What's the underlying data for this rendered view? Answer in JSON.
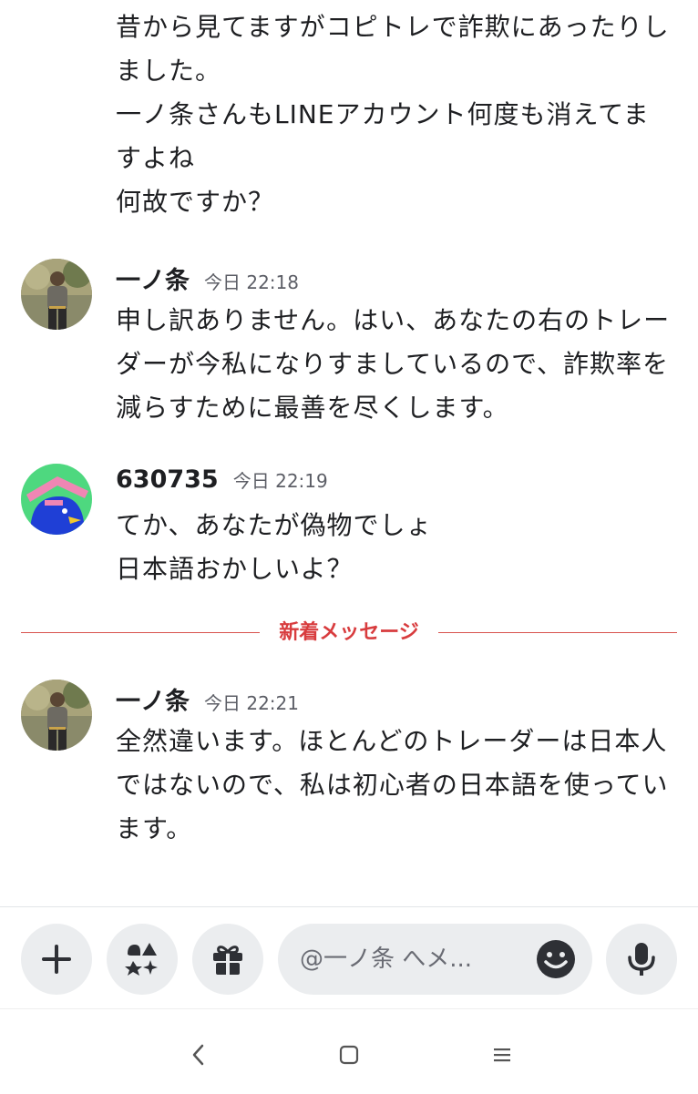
{
  "messages": {
    "m0": {
      "lines": "昔から見てますがコピトレで詐欺にあったりしました。\n一ノ条さんもLINEアカウント何度も消えてますよね\n何故ですか？"
    },
    "m1": {
      "author": "一ノ条",
      "time": "今日 22:18",
      "lines": "申し訳ありません。はい、あなたの右のトレーダーが今私になりすましているので、詐欺率を減らすために最善を尽くします。"
    },
    "m2": {
      "author": "630735",
      "time": "今日 22:19",
      "lines": "てか、あなたが偽物でしょ\n日本語おかしいよ？"
    },
    "m3": {
      "author": "一ノ条",
      "time": "今日 22:21",
      "lines": "全然違います。ほとんどのトレーダーは日本人ではないので、私は初心者の日本語を使っています。"
    }
  },
  "divider": {
    "label": "新着メッセージ",
    "color": "#d83c3e"
  },
  "composer": {
    "placeholder": "@一ノ条 へメ...",
    "buttons": [
      "plus-icon",
      "apps-icon",
      "gift-icon",
      "emoji-icon",
      "mic-icon"
    ]
  },
  "nav": {
    "icons": [
      "back-icon",
      "home-icon",
      "recents-icon"
    ]
  },
  "colors": {
    "text": "#1e1f22",
    "muted": "#5c5e66",
    "button_bg": "#ebedef",
    "avatar2_bg": "#4ed87f"
  }
}
